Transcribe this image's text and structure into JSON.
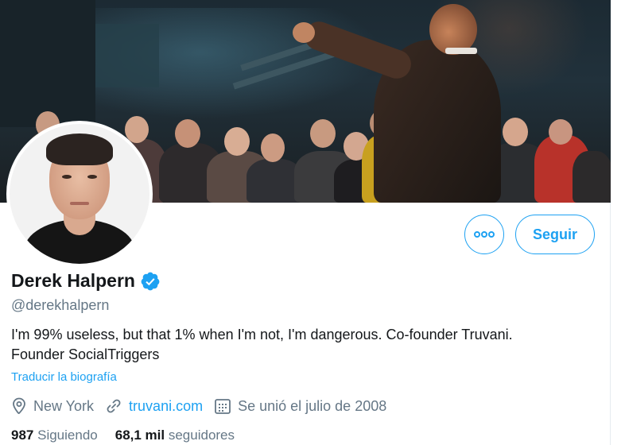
{
  "profile": {
    "name": "Derek Halpern",
    "handle": "@derekhalpern",
    "bio": "I'm 99% useless, but that 1% when I'm not, I'm dangerous. Co-founder Truvani. Founder SocialTriggers",
    "translate_label": "Traducir la biografía",
    "verified": true
  },
  "actions": {
    "more_icon": "more-dots-icon",
    "follow_label": "Seguir"
  },
  "meta": {
    "location": "New York",
    "location_icon": "location-pin-icon",
    "website": "truvani.com",
    "website_icon": "link-icon",
    "joined": "Se unió el julio de 2008",
    "joined_icon": "calendar-icon"
  },
  "stats": {
    "following_count": "987",
    "following_label": "Siguiendo",
    "followers_count": "68,1 mil",
    "followers_label": "seguidores"
  },
  "colors": {
    "accent": "#1da1f2",
    "secondary_text": "#657786",
    "primary_text": "#14171a"
  }
}
